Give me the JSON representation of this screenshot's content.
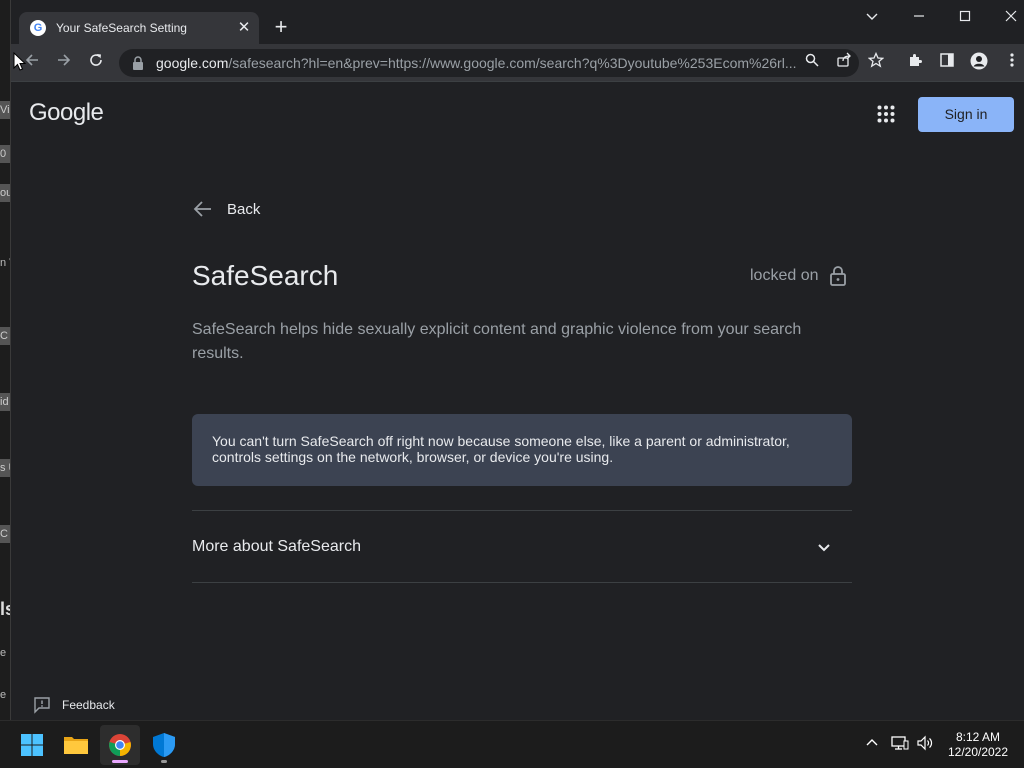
{
  "browser": {
    "tab_title": "Your SafeSearch Setting",
    "url_host": "google.com",
    "url_rest": "/safesearch?hl=en&prev=https://www.google.com/search?q%3Dyoutube%253Ecom%26rl..."
  },
  "header": {
    "logo_text": "Google",
    "signin_label": "Sign in"
  },
  "main": {
    "back_label": "Back",
    "title": "SafeSearch",
    "status": "locked on",
    "description": "SafeSearch helps hide sexually explicit content and graphic violence from your search results.",
    "notice_line1": "You can't turn SafeSearch off right now because someone else, like a parent or administrator,",
    "notice_line2": "controls settings on the network, browser, or device you're using.",
    "more_label": "More about SafeSearch"
  },
  "footer": {
    "feedback_label": "Feedback"
  },
  "taskbar": {
    "time": "8:12 AM",
    "date": "12/20/2022"
  },
  "background_window": {
    "fragments": [
      "Vi",
      "0",
      "ou",
      "n V",
      "C",
      "id",
      "s U",
      "C",
      "ls",
      "e",
      "e"
    ]
  },
  "colors": {
    "page_bg": "#202124",
    "signin_bg": "#8ab4f8",
    "notice_bg": "#3c4352",
    "text_primary": "#e8eaed",
    "text_secondary": "#9aa0a6"
  }
}
